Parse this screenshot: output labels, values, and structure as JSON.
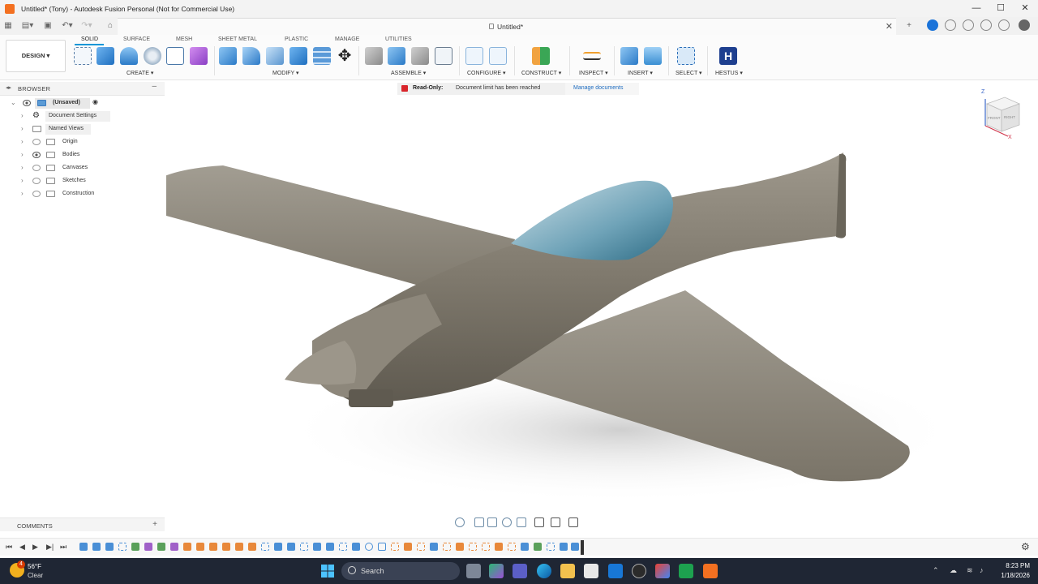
{
  "window": {
    "title": "Untitled* (Tony) - Autodesk Fusion Personal (Not for Commercial Use)",
    "controls": {
      "minimize": "—",
      "maximize": "☐",
      "close": "✕"
    }
  },
  "doc_tab": {
    "title": "Untitled*",
    "close": "✕"
  },
  "workspace": {
    "design_label": "DESIGN",
    "tabs": [
      "SOLID",
      "SURFACE",
      "MESH",
      "SHEET METAL",
      "PLASTIC",
      "MANAGE",
      "UTILITIES"
    ],
    "active_tab": "SOLID"
  },
  "toolbar_groups": [
    "CREATE",
    "MODIFY",
    "ASSEMBLE",
    "CONFIGURE",
    "CONSTRUCT",
    "INSPECT",
    "INSERT",
    "SELECT",
    "HESTUS"
  ],
  "browser": {
    "title": "BROWSER",
    "root": "(Unsaved)",
    "items": [
      "Document Settings",
      "Named Views",
      "Origin",
      "Bodies",
      "Canvases",
      "Sketches",
      "Construction"
    ]
  },
  "banner": {
    "readonly_label": "Read-Only:",
    "message": "Document limit has been reached",
    "link": "Manage documents"
  },
  "viewcube": {
    "axis_z": "Z",
    "axis_x": "X",
    "front": "FRONT",
    "right": "RIGHT"
  },
  "comments": {
    "title": "COMMENTS",
    "add": "+"
  },
  "taskbar": {
    "temperature": "56°F",
    "condition": "Clear",
    "weather_badge": "4",
    "search_placeholder": "Search",
    "time": "8:23 PM",
    "date": "1/18/2026"
  },
  "colors": {
    "accent": "#0696d7",
    "fusion_orange": "#f37021",
    "readonly_red": "#d9262c",
    "body_gray": "#8a8478",
    "canopy_blue": "#4f8aa1"
  }
}
